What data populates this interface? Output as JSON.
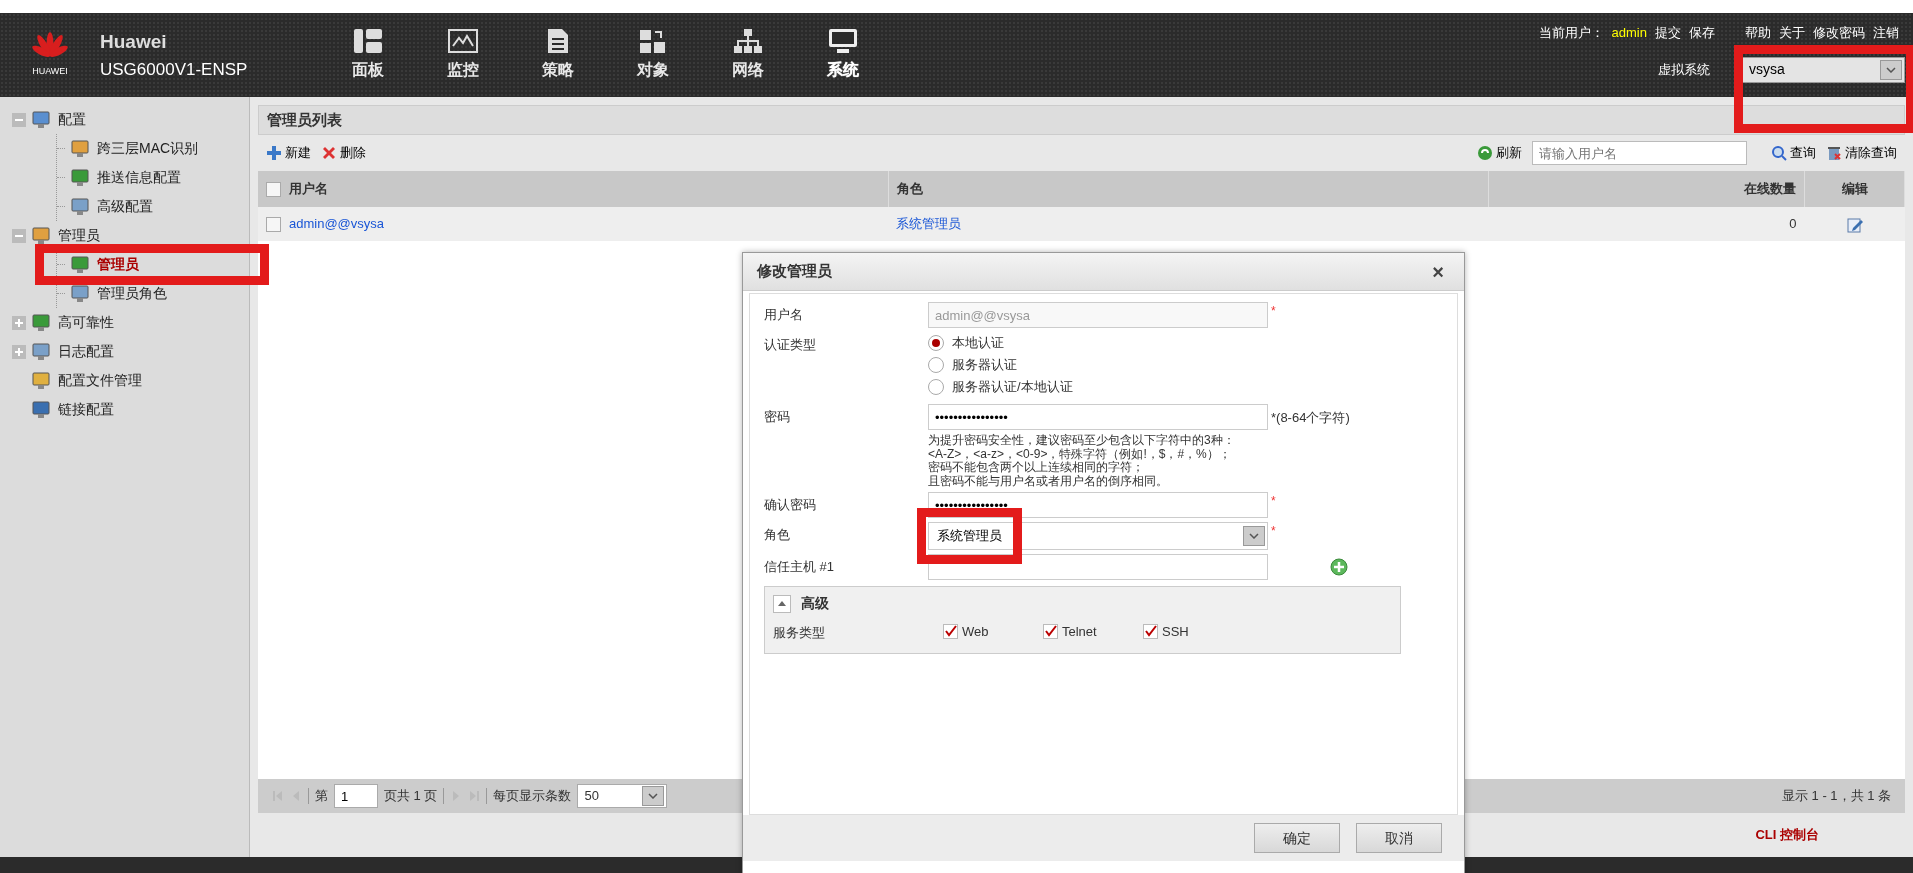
{
  "header": {
    "brand": "HUAWEI",
    "product_name": "Huawei",
    "model": "USG6000V1-ENSP",
    "nav": [
      {
        "label": "面板",
        "selected": false
      },
      {
        "label": "监控",
        "selected": false
      },
      {
        "label": "策略",
        "selected": false
      },
      {
        "label": "对象",
        "selected": false
      },
      {
        "label": "网络",
        "selected": false
      },
      {
        "label": "系统",
        "selected": true
      }
    ],
    "user_label": "当前用户：",
    "user": "admin",
    "actions_left": [
      "提交",
      "保存"
    ],
    "actions_right": [
      "帮助",
      "关于",
      "修改密码",
      "注销"
    ],
    "vsys_label": "虚拟系统",
    "vsys_value": "vsysa",
    "vsys_highlighted": true
  },
  "sidebar": {
    "items": [
      {
        "label": "配置",
        "kind": "group",
        "expanded": true,
        "selected": false,
        "children": [
          {
            "label": "跨三层MAC识别",
            "selected": false,
            "highlighted": false
          },
          {
            "label": "推送信息配置",
            "selected": false,
            "highlighted": false
          },
          {
            "label": "高级配置",
            "selected": false,
            "highlighted": false
          }
        ]
      },
      {
        "label": "管理员",
        "kind": "group",
        "expanded": true,
        "selected": false,
        "children": [
          {
            "label": "管理员",
            "selected": true,
            "highlighted": true
          },
          {
            "label": "管理员角色",
            "selected": false,
            "highlighted": false
          }
        ]
      },
      {
        "label": "高可靠性",
        "kind": "group",
        "expanded": false,
        "selected": false
      },
      {
        "label": "日志配置",
        "kind": "group",
        "expanded": false,
        "selected": false
      },
      {
        "label": "配置文件管理",
        "kind": "link",
        "selected": false
      },
      {
        "label": "链接配置",
        "kind": "link",
        "selected": false
      }
    ]
  },
  "panel": {
    "title": "管理员列表",
    "toolbar": [
      "新建",
      "删除"
    ],
    "refresh": "刷新",
    "search": {
      "placeholder": "请输入用户名"
    },
    "query": "查询",
    "clear_query": "清除查询",
    "table": {
      "all_checked": false,
      "columns": [
        "用户名",
        "角色",
        "在线数量",
        "编辑"
      ],
      "rows": [
        {
          "checked": false,
          "username": "admin@@vsysa",
          "role": "系统管理员",
          "online": "0"
        }
      ]
    },
    "pager": {
      "page_prefix": "第",
      "page": "1",
      "page_suffix": "页共 1 页",
      "per_page_label": "每页显示条数",
      "per_page": "50",
      "summary": "显示 1 - 1，共 1 条"
    }
  },
  "cli_console": "CLI 控制台",
  "dialog": {
    "title": "修改管理员",
    "close": "×",
    "username": {
      "label": "用户名",
      "value": "admin@@vsysa",
      "disabled": true,
      "required": "*"
    },
    "auth": {
      "label": "认证类型",
      "options": [
        {
          "label": "本地认证",
          "selected": true
        },
        {
          "label": "服务器认证",
          "selected": false
        },
        {
          "label": "服务器认证/本地认证",
          "selected": false
        }
      ]
    },
    "password": {
      "label": "密码",
      "value": "••••••••••••••••",
      "hint": "*(8-64个字符)",
      "notes": [
        "为提升密码安全性，建议密码至少包含以下字符中的3种：",
        "<A-Z>，<a-z>，<0-9>，特殊字符（例如!，$，#，%）；",
        "密码不能包含两个以上连续相同的字符；",
        "且密码不能与用户名或者用户名的倒序相同。"
      ]
    },
    "confirm": {
      "label": "确认密码",
      "value": "••••••••••••••••",
      "required": "*"
    },
    "role": {
      "label": "角色",
      "value": "系统管理员",
      "required": "*",
      "highlighted": true
    },
    "trusted_host": {
      "label": "信任主机 #1"
    },
    "advanced": {
      "title": "高级",
      "expanded": true,
      "service_label": "服务类型",
      "services": [
        {
          "label": "Web",
          "checked": true
        },
        {
          "label": "Telnet",
          "checked": true
        },
        {
          "label": "SSH",
          "checked": true
        }
      ]
    },
    "buttons": [
      "确定",
      "取消"
    ]
  }
}
